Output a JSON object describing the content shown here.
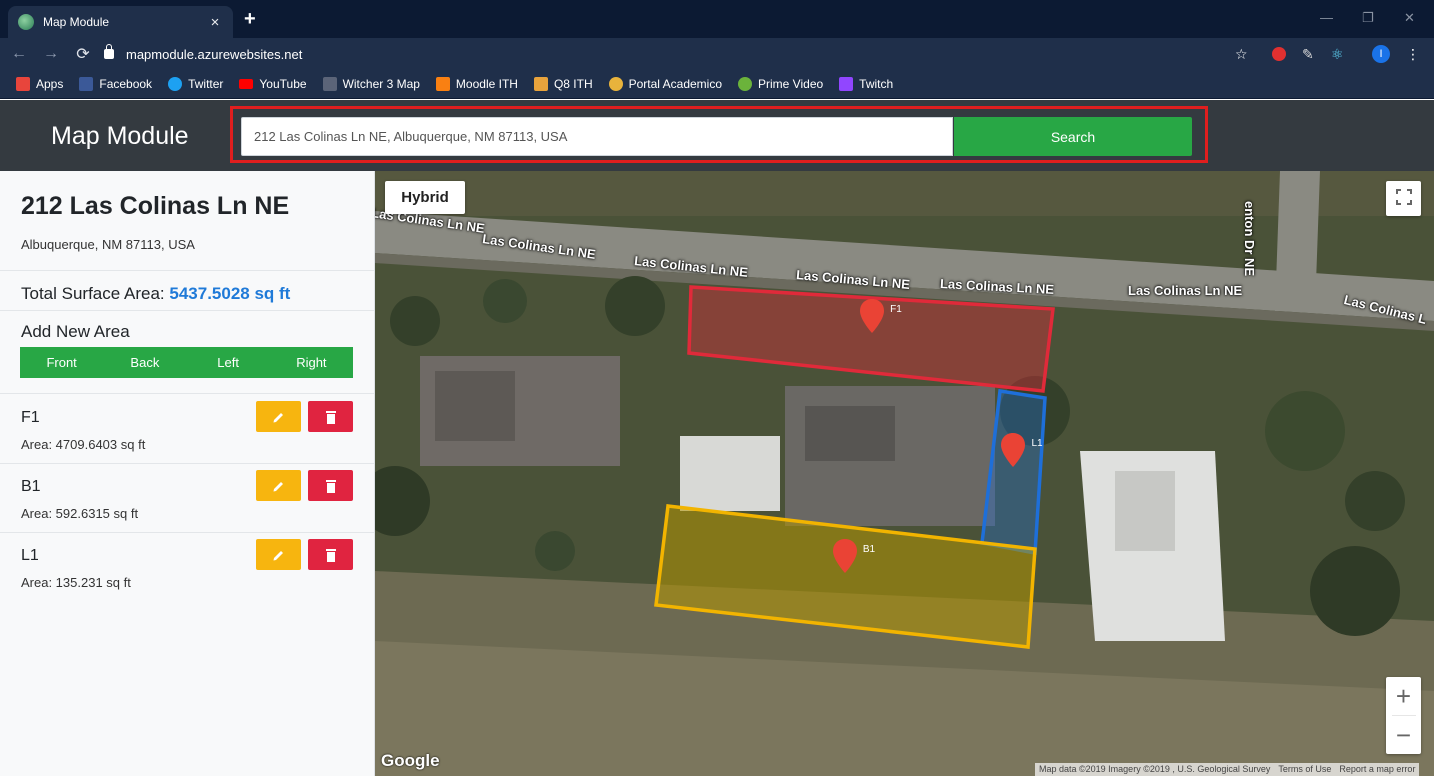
{
  "browser": {
    "tab_title": "Map Module",
    "tab_close": "×",
    "new_tab": "+",
    "url": "mapmodule.azurewebsites.net",
    "window_controls": [
      "—",
      "❐",
      "✕"
    ],
    "bookmarks": [
      {
        "label": "Apps",
        "icon": "apps-grid-icon",
        "color": "#e8453c"
      },
      {
        "label": "Facebook",
        "icon": "facebook-icon",
        "color": "#3b5998"
      },
      {
        "label": "Twitter",
        "icon": "twitter-icon",
        "color": "#1da1f2"
      },
      {
        "label": "YouTube",
        "icon": "youtube-icon",
        "color": "#ff0000"
      },
      {
        "label": "Witcher 3 Map",
        "icon": "witcher-icon",
        "color": "#5b6478"
      },
      {
        "label": "Moodle ITH",
        "icon": "moodle-icon",
        "color": "#f98012"
      },
      {
        "label": "Q8 ITH",
        "icon": "q8-icon",
        "color": "#e8a33c"
      },
      {
        "label": "Portal Academico",
        "icon": "portal-icon",
        "color": "#e8b33c"
      },
      {
        "label": "Prime Video",
        "icon": "prime-video-icon",
        "color": "#6bb33b"
      },
      {
        "label": "Twitch",
        "icon": "twitch-icon",
        "color": "#9146ff"
      }
    ],
    "profile_initial": "I"
  },
  "header": {
    "brand": "Map Module",
    "search_value": "212 Las Colinas Ln NE, Albuquerque, NM 87113, USA",
    "search_button": "Search"
  },
  "sidebar": {
    "address_line1": "212 Las Colinas Ln NE",
    "address_line2": "Albuquerque, NM 87113, USA",
    "total_label": "Total Surface Area:",
    "total_value": "5437.5028 sq ft",
    "add_title": "Add New Area",
    "add_buttons": [
      "Front",
      "Back",
      "Left",
      "Right"
    ],
    "areas": [
      {
        "name": "F1",
        "area": "Area: 4709.6403 sq ft"
      },
      {
        "name": "B1",
        "area": "Area: 592.6315 sq ft"
      },
      {
        "name": "L1",
        "area": "Area: 135.231 sq ft"
      }
    ]
  },
  "map": {
    "type_button": "Hybrid",
    "zoom_in": "+",
    "zoom_out": "−",
    "google_logo": "Google",
    "streets": [
      "Las Colinas Ln NE",
      "Las Colinas Ln NE",
      "Las Colinas Ln NE",
      "Las Colinas Ln NE",
      "Las Colinas Ln NE",
      "Las Colinas Ln NE",
      "Las Colinas L",
      "Las Colinas Ln NE",
      "enton Dr NE"
    ],
    "attribution": [
      "Map data ©2019 Imagery ©2019 , U.S. Geological Survey",
      "Terms of Use",
      "Report a map error"
    ],
    "markers": [
      "F1",
      "L1",
      "B1"
    ],
    "colors": {
      "front": "#e02a3a",
      "left": "#1e6fd9",
      "back": "#f2b400",
      "marker": "#ea4335"
    }
  }
}
